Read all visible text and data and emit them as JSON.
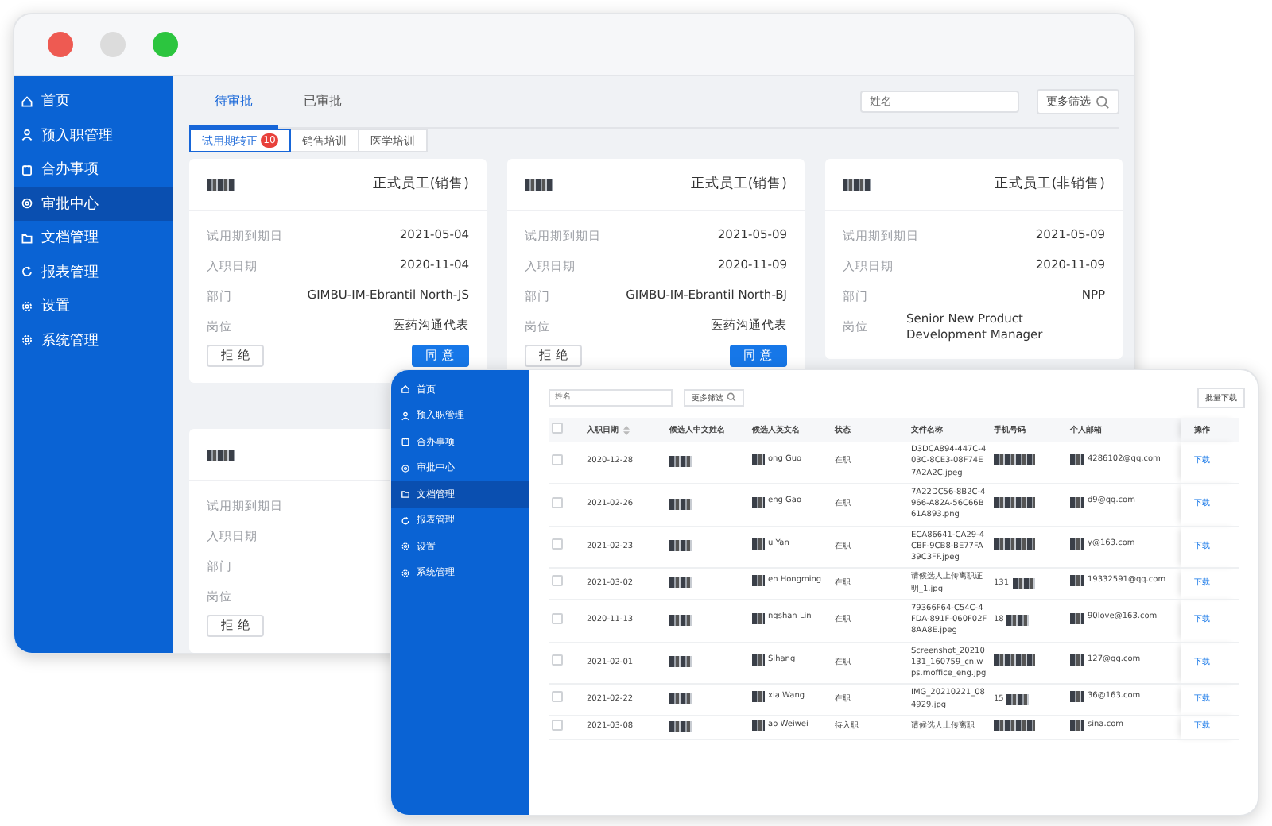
{
  "back_window": {
    "sidebar": {
      "items": [
        {
          "label": "首页",
          "selected": false
        },
        {
          "label": "预入职管理",
          "selected": false
        },
        {
          "label": "合办事项",
          "selected": false
        },
        {
          "label": "审批中心",
          "selected": true
        },
        {
          "label": "文档管理",
          "selected": false
        },
        {
          "label": "报表管理",
          "selected": false
        },
        {
          "label": "设置",
          "selected": false
        },
        {
          "label": "系统管理",
          "selected": false
        }
      ]
    },
    "tabs": [
      {
        "label": "待审批",
        "selected": true
      },
      {
        "label": "已审批",
        "selected": false
      }
    ],
    "search": {
      "placeholder": "姓名"
    },
    "filter_button": "更多筛选",
    "subtabs": [
      {
        "label": "试用期转正",
        "badge": "10",
        "selected": true
      },
      {
        "label": "销售培训",
        "selected": false
      },
      {
        "label": "医学培训",
        "selected": false
      }
    ],
    "cards": [
      {
        "type": "正式员工(销售)",
        "fields": [
          {
            "label": "试用期到期日",
            "value": "2021-05-04"
          },
          {
            "label": "入职日期",
            "value": "2020-11-04"
          },
          {
            "label": "部门",
            "value": "GIMBU-IM-Ebrantil North-JS"
          },
          {
            "label": "岗位",
            "value": "医药沟通代表"
          }
        ],
        "buttons": [
          {
            "label": "拒 绝",
            "kind": "default"
          },
          {
            "label": "同 意",
            "kind": "primary"
          }
        ]
      },
      {
        "type": "正式员工(销售)",
        "fields": [
          {
            "label": "试用期到期日",
            "value": "2021-05-09"
          },
          {
            "label": "入职日期",
            "value": "2020-11-09"
          },
          {
            "label": "部门",
            "value": "GIMBU-IM-Ebrantil North-BJ"
          },
          {
            "label": "岗位",
            "value": "医药沟通代表"
          }
        ],
        "buttons": [
          {
            "label": "拒 绝",
            "kind": "default"
          },
          {
            "label": "同 意",
            "kind": "primary"
          }
        ]
      },
      {
        "type": "正式员工(非销售)",
        "fields": [
          {
            "label": "试用期到期日",
            "value": "2021-05-09"
          },
          {
            "label": "入职日期",
            "value": "2020-11-09"
          },
          {
            "label": "部门",
            "value": "NPP"
          },
          {
            "label": "岗位",
            "value": "Senior New Product Development Manager"
          }
        ]
      },
      {
        "fields": [
          {
            "label": "试用期到期日"
          },
          {
            "label": "入职日期"
          },
          {
            "label": "部门"
          },
          {
            "label": "岗位"
          }
        ],
        "buttons": [
          {
            "label": "拒 绝",
            "kind": "default"
          }
        ]
      }
    ]
  },
  "front_window": {
    "sidebar": {
      "items": [
        {
          "label": "首页",
          "selected": false
        },
        {
          "label": "预入职管理",
          "selected": false
        },
        {
          "label": "合办事项",
          "selected": false
        },
        {
          "label": "审批中心",
          "selected": false
        },
        {
          "label": "文档管理",
          "selected": true
        },
        {
          "label": "报表管理",
          "selected": false
        },
        {
          "label": "设置",
          "selected": false
        },
        {
          "label": "系统管理",
          "selected": false
        }
      ]
    },
    "search": {
      "placeholder": "姓名"
    },
    "filter_button": "更多筛选",
    "batch_button": "批量下载",
    "table": {
      "header_checkbox": {
        "checked": false
      },
      "columns": [
        {
          "label": "入职日期",
          "sortable": true
        },
        {
          "label": "候选人中文姓名",
          "sortable": false
        },
        {
          "label": "候选人英文名",
          "sortable": false
        },
        {
          "label": "状态",
          "sortable": false
        },
        {
          "label": "文件名称",
          "sortable": false
        },
        {
          "label": "手机号码",
          "sortable": false
        },
        {
          "label": "个人邮箱",
          "sortable": false
        },
        {
          "label": "操作",
          "sortable": false
        }
      ],
      "rows": [
        {
          "checked": false,
          "date": "2020-12-28",
          "en_name": "ong Guo",
          "status": "在职",
          "file": "D3DCA894-447C-403C-8CE3-08F74E7A2A2C.jpeg",
          "email": "4286102@qq.com",
          "action": "下载"
        },
        {
          "checked": false,
          "date": "2021-02-26",
          "en_name": "eng Gao",
          "status": "在职",
          "file": "7A22DC56-8B2C-4966-A82A-56C66B61A893.png",
          "email": "d9@qq.com",
          "action": "下载"
        },
        {
          "checked": false,
          "date": "2021-02-23",
          "en_name": "u Yan",
          "status": "在职",
          "file": "ECA86641-CA29-4CBF-9CB8-BE77FA39C3FF.jpeg",
          "email": "y@163.com",
          "action": "下载"
        },
        {
          "checked": false,
          "date": "2021-03-02",
          "en_name": "en Hongming",
          "status": "在职",
          "file": "请候选人上传离职证明_1.jpg",
          "phone": "131",
          "email": "19332591@qq.com",
          "action": "下载"
        },
        {
          "checked": false,
          "date": "2020-11-13",
          "en_name": "ngshan Lin",
          "status": "在职",
          "file": "79366F64-C54C-4FDA-891F-060F02F8AA8E.jpeg",
          "phone": "18",
          "email": "90love@163.com",
          "action": "下载"
        },
        {
          "checked": false,
          "date": "2021-02-01",
          "en_name": "Sihang",
          "status": "在职",
          "file": "Screenshot_20210131_160759_cn.wps.moffice_eng.jpg",
          "email": "127@qq.com",
          "action": "下载"
        },
        {
          "checked": false,
          "date": "2021-02-22",
          "en_name": "xia Wang",
          "status": "在职",
          "file": "IMG_20210221_084929.jpg",
          "phone": "15",
          "email": "36@163.com",
          "action": "下载"
        },
        {
          "checked": false,
          "date": "2021-03-08",
          "en_name": "ao Weiwei",
          "status": "待入职",
          "file": "请候选人上传离职",
          "email": "sina.com",
          "action": "下载"
        }
      ]
    }
  }
}
